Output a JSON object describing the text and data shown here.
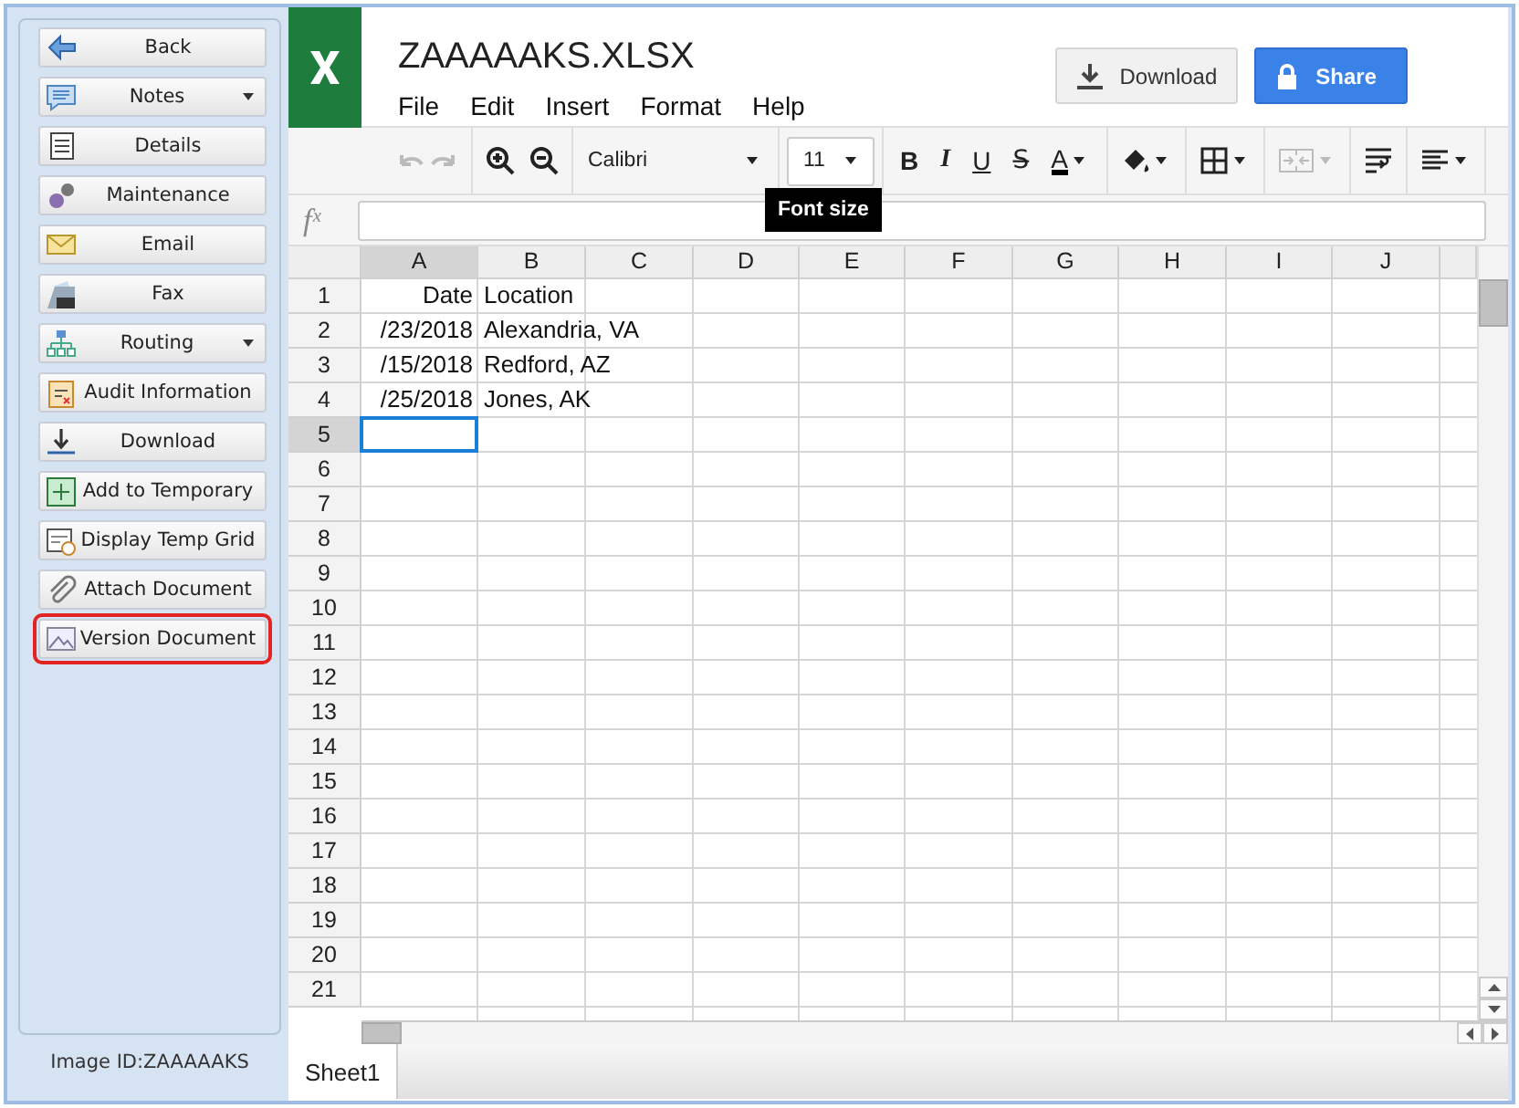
{
  "sidebar": {
    "buttons": [
      {
        "label": "Back",
        "kind": "button",
        "selected": false
      },
      {
        "label": "Notes",
        "kind": "dropdown",
        "selected": false
      },
      {
        "label": "Details",
        "kind": "button",
        "selected": false
      },
      {
        "label": "Maintenance",
        "kind": "button",
        "selected": false
      },
      {
        "label": "Email",
        "kind": "button",
        "selected": false
      },
      {
        "label": "Fax",
        "kind": "button",
        "selected": false
      },
      {
        "label": "Routing",
        "kind": "dropdown",
        "selected": false
      },
      {
        "label": "Audit Information",
        "kind": "button",
        "selected": false
      },
      {
        "label": "Download",
        "kind": "button",
        "selected": false
      },
      {
        "label": "Add to Temporary",
        "kind": "button",
        "selected": false
      },
      {
        "label": "Display Temp Grid",
        "kind": "button",
        "selected": false
      },
      {
        "label": "Attach Document",
        "kind": "button",
        "selected": false
      },
      {
        "label": "Version Document",
        "kind": "button",
        "selected": true
      }
    ],
    "image_id": "Image ID:ZAAAAAKS"
  },
  "document": {
    "title": "ZAAAAAKS.XLSX",
    "menu": [
      "File",
      "Edit",
      "Insert",
      "Format",
      "Help"
    ],
    "download_button": "Download",
    "share_button": "Share"
  },
  "toolbar": {
    "undo_disabled": true,
    "font": "Calibri",
    "font_size": "11",
    "tooltip": "Font size",
    "format_buttons": [
      {
        "label": "B",
        "kind": "bold"
      },
      {
        "label": "I",
        "kind": "italic"
      },
      {
        "label": "U",
        "kind": "underline"
      },
      {
        "label": "S̶",
        "kind": "strike"
      },
      {
        "label": "A",
        "kind": "color"
      }
    ],
    "merge_disabled": true
  },
  "formula_bar": {
    "label": "fˣ"
  },
  "sheet": {
    "columns": [
      {
        "label": "A",
        "selected": true
      },
      {
        "label": "B",
        "selected": false
      },
      {
        "label": "C",
        "selected": false
      },
      {
        "label": "D",
        "selected": false
      },
      {
        "label": "E",
        "selected": false
      },
      {
        "label": "F",
        "selected": false
      },
      {
        "label": "G",
        "selected": false
      },
      {
        "label": "H",
        "selected": false
      },
      {
        "label": "I",
        "selected": false
      },
      {
        "label": "J",
        "selected": false
      }
    ],
    "rows": [
      {
        "number": "1",
        "selected": false,
        "cells": [
          "Date",
          "Location"
        ]
      },
      {
        "number": "2",
        "selected": false,
        "cells": [
          "/23/2018",
          "Alexandria, VA"
        ]
      },
      {
        "number": "3",
        "selected": false,
        "cells": [
          "/15/2018",
          "Redford, AZ"
        ]
      },
      {
        "number": "4",
        "selected": false,
        "cells": [
          "/25/2018",
          "Jones, AK"
        ]
      },
      {
        "number": "5",
        "selected": true
      },
      {
        "number": "6",
        "selected": false
      },
      {
        "number": "7",
        "selected": false
      },
      {
        "number": "8",
        "selected": false
      },
      {
        "number": "9",
        "selected": false
      },
      {
        "number": "10",
        "selected": false
      },
      {
        "number": "11",
        "selected": false
      },
      {
        "number": "12",
        "selected": false
      },
      {
        "number": "13",
        "selected": false
      },
      {
        "number": "14",
        "selected": false
      },
      {
        "number": "15",
        "selected": false
      },
      {
        "number": "16",
        "selected": false
      },
      {
        "number": "17",
        "selected": false
      },
      {
        "number": "18",
        "selected": false
      },
      {
        "number": "19",
        "selected": false
      },
      {
        "number": "20",
        "selected": false
      },
      {
        "number": "21",
        "selected": false
      }
    ],
    "tabs": [
      {
        "label": "Sheet1",
        "selected": true
      }
    ]
  }
}
